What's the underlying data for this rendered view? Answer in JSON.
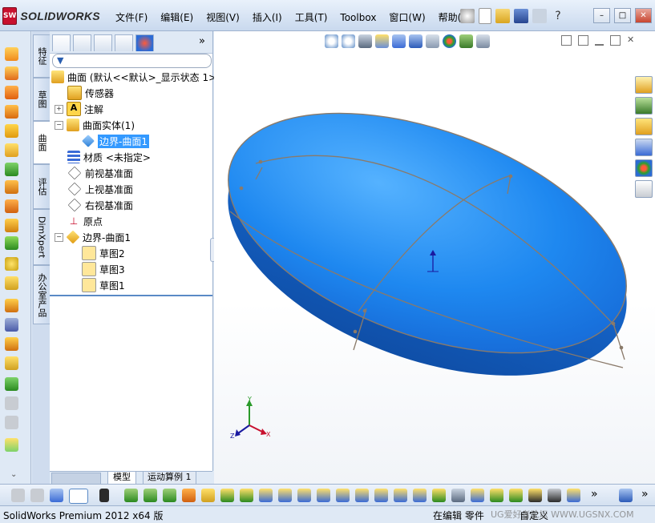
{
  "app": {
    "logo_badge": "SW",
    "logo_text": "SOLIDWORKS"
  },
  "menu": [
    "文件(F)",
    "编辑(E)",
    "视图(V)",
    "插入(I)",
    "工具(T)",
    "Toolbox",
    "窗口(W)",
    "帮助(H)"
  ],
  "window_controls": {
    "minimize": "–",
    "restore": "□",
    "close": "✕"
  },
  "vertical_tabs": [
    "特征",
    "草图",
    "曲面",
    "评估",
    "DimXpert",
    "办公室产品"
  ],
  "vertical_tab_active": "曲面",
  "feature_tree": {
    "root": "曲面 (默认<<默认>_显示状态 1>)",
    "items": [
      {
        "label": "传感器",
        "expander": ""
      },
      {
        "label": "注解",
        "expander": "+"
      },
      {
        "label": "曲面实体(1)",
        "expander": "−"
      },
      {
        "label": "边界-曲面1",
        "expander": "",
        "selected": true
      },
      {
        "label": "材质 <未指定>",
        "expander": ""
      },
      {
        "label": "前视基准面",
        "expander": ""
      },
      {
        "label": "上视基准面",
        "expander": ""
      },
      {
        "label": "右视基准面",
        "expander": ""
      },
      {
        "label": "原点",
        "expander": ""
      },
      {
        "label": "边界-曲面1",
        "expander": "−"
      },
      {
        "label": "草图2",
        "expander": ""
      },
      {
        "label": "草图3",
        "expander": ""
      },
      {
        "label": "草图1",
        "expander": ""
      }
    ],
    "more_chevron": "»"
  },
  "bottom_tabs": [
    "模型",
    "运动算例 1"
  ],
  "triad": {
    "x": "X",
    "y": "Y",
    "z": "Z"
  },
  "status": {
    "left": "SolidWorks Premium 2012 x64 版",
    "mode": "在编辑 零件",
    "right": "自定义",
    "watermark": "UG爱好者论坛 WWW.UGSNX.COM"
  },
  "toolbar_more": "»",
  "colors": {
    "surface_top": "#1e88f0",
    "surface_side": "#1662c8",
    "accent": "#3399ff",
    "sketch": "#8a7a6a"
  }
}
